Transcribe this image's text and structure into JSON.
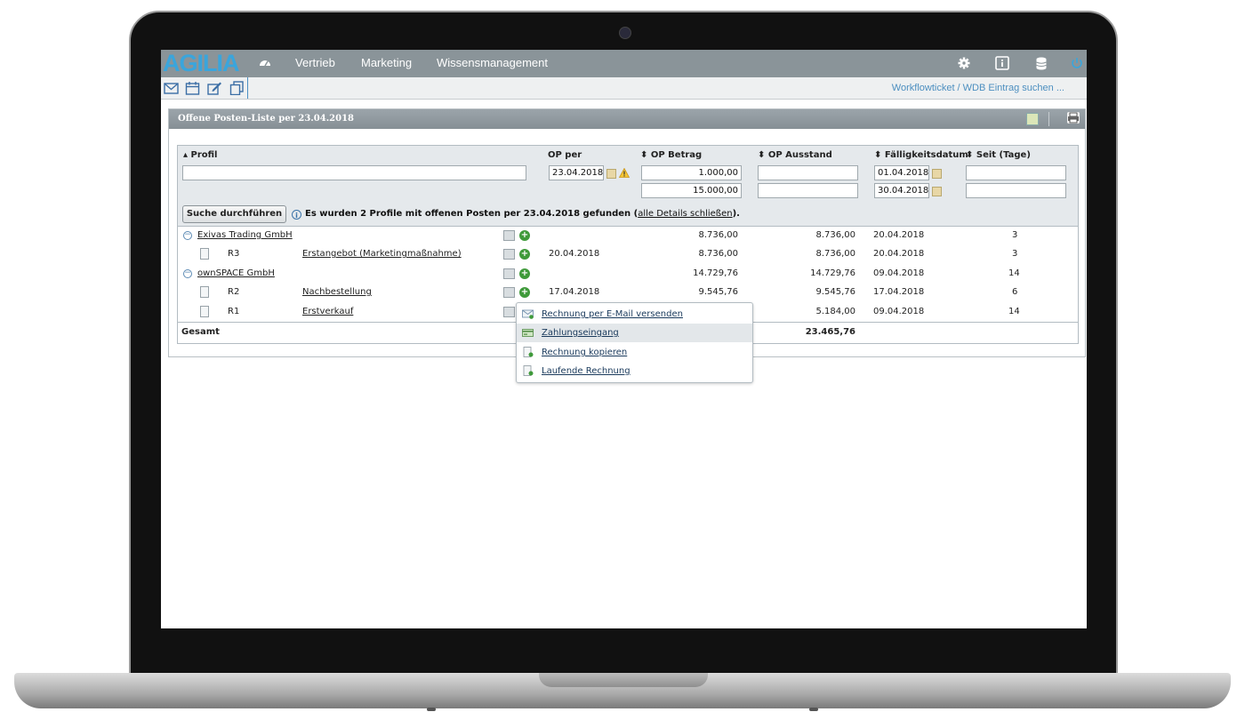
{
  "app": {
    "logo": "AGILIA",
    "nav": [
      "Vertrieb",
      "Marketing",
      "Wissensmanagement"
    ],
    "search_link": "Workflowticket / WDB Eintrag suchen ...",
    "accent": "#3aa5dc",
    "topbar_color": "#8a9499"
  },
  "toolbar_icons": [
    "mail-icon",
    "calendar-icon",
    "edit-icon",
    "copy-icon"
  ],
  "topbar_icons": [
    "dashboard-icon",
    "gear-icon",
    "info-icon",
    "database-icon",
    "power-icon"
  ],
  "panel": {
    "title": "Offene Posten-Liste per 23.04.2018"
  },
  "columns": {
    "profil": "▴ Profil",
    "op_per": "OP per",
    "op_betrag": "⬍ OP Betrag",
    "op_ausstand": "⬍ OP Ausstand",
    "faelligkeit": "⬍ Fälligkeitsdatum",
    "seit": "⬍ Seit (Tage)"
  },
  "filters": {
    "profil": "",
    "op_per": "23.04.2018",
    "betrag_von": "1.000,00",
    "betrag_bis": "15.000,00",
    "ausstand_von": "",
    "ausstand_bis": "",
    "faellig_von": "01.04.2018",
    "faellig_bis": "30.04.2018",
    "seit_von": "",
    "seit_bis": ""
  },
  "search": {
    "button": "Suche durchführen",
    "info_text": "Es wurden 2 Profile mit offenen Posten per 23.04.2018 gefunden (",
    "info_link": "alle Details schließen",
    "info_end": ")."
  },
  "rows": [
    {
      "type": "group",
      "name": "Exivas Trading GmbH",
      "op_per": "",
      "betrag": "8.736,00",
      "ausstand": "8.736,00",
      "faellig": "20.04.2018",
      "seit": "3"
    },
    {
      "type": "item",
      "nr": "R3",
      "name": "Erstangebot (Marketingmaßnahme)",
      "op_per": "20.04.2018",
      "betrag": "8.736,00",
      "ausstand": "8.736,00",
      "faellig": "20.04.2018",
      "seit": "3"
    },
    {
      "type": "group",
      "name": "ownSPACE GmbH",
      "op_per": "",
      "betrag": "14.729,76",
      "ausstand": "14.729,76",
      "faellig": "09.04.2018",
      "seit": "14"
    },
    {
      "type": "item",
      "nr": "R2",
      "name": "Nachbestellung",
      "op_per": "17.04.2018",
      "betrag": "9.545,76",
      "ausstand": "9.545,76",
      "faellig": "17.04.2018",
      "seit": "6"
    },
    {
      "type": "item",
      "nr": "R1",
      "name": "Erstverkauf",
      "op_per": "",
      "betrag": "",
      "ausstand": "5.184,00",
      "faellig": "09.04.2018",
      "seit": "14"
    }
  ],
  "total": {
    "label": "Gesamt",
    "ausstand": "23.465,76"
  },
  "context_menu": [
    "Rechnung per E-Mail versenden",
    "Zahlungseingang",
    "Rechnung kopieren",
    "Laufende Rechnung"
  ]
}
